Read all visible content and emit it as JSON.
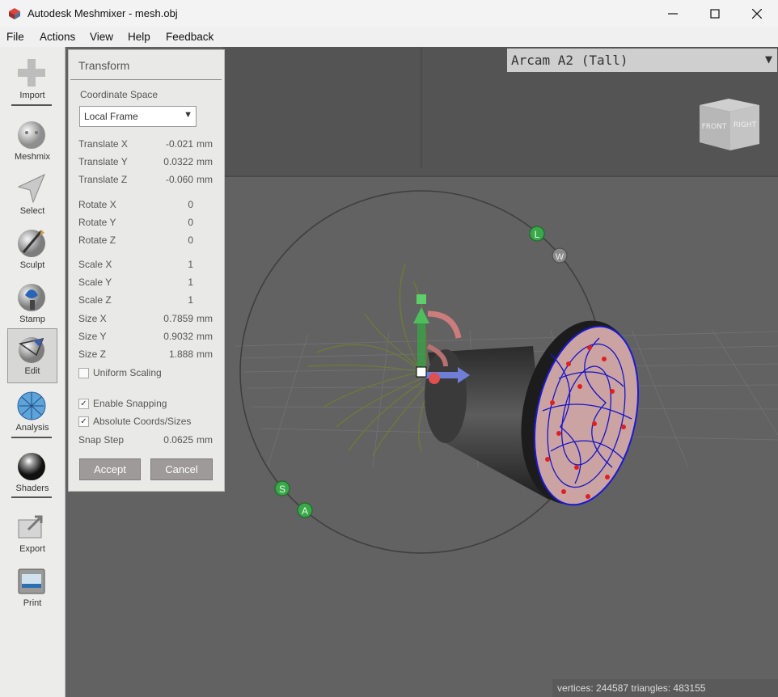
{
  "window": {
    "title": "Autodesk Meshmixer - mesh.obj"
  },
  "menu": [
    "File",
    "Actions",
    "View",
    "Help",
    "Feedback"
  ],
  "toolbar": {
    "items": [
      "Import",
      "Meshmix",
      "Select",
      "Sculpt",
      "Stamp",
      "Edit",
      "Analysis",
      "Shaders",
      "Export",
      "Print"
    ],
    "active": "Edit"
  },
  "printer": {
    "selected": "Arcam A2 (Tall)"
  },
  "viewcube": {
    "front": "FRONT",
    "right": "RIGHT"
  },
  "gizmo": {
    "handles": [
      "L",
      "W",
      "S",
      "A"
    ]
  },
  "panel": {
    "title": "Transform",
    "coord_label": "Coordinate Space",
    "coord_value": "Local Frame",
    "fields": [
      {
        "label": "Translate X",
        "value": "-0.021",
        "unit": "mm"
      },
      {
        "label": "Translate Y",
        "value": "0.0322",
        "unit": "mm"
      },
      {
        "label": "Translate Z",
        "value": "-0.060",
        "unit": "mm"
      },
      {
        "label": "Rotate X",
        "value": "0",
        "unit": ""
      },
      {
        "label": "Rotate Y",
        "value": "0",
        "unit": ""
      },
      {
        "label": "Rotate Z",
        "value": "0",
        "unit": ""
      },
      {
        "label": "Scale X",
        "value": "1",
        "unit": ""
      },
      {
        "label": "Scale Y",
        "value": "1",
        "unit": ""
      },
      {
        "label": "Scale Z",
        "value": "1",
        "unit": ""
      },
      {
        "label": "Size X",
        "value": "0.7859",
        "unit": "mm"
      },
      {
        "label": "Size Y",
        "value": "0.9032",
        "unit": "mm"
      },
      {
        "label": "Size Z",
        "value": "1.888",
        "unit": "mm"
      }
    ],
    "uniform_scaling": {
      "label": "Uniform Scaling",
      "checked": false
    },
    "enable_snapping": {
      "label": "Enable Snapping",
      "checked": true
    },
    "absolute_coords": {
      "label": "Absolute Coords/Sizes",
      "checked": true
    },
    "snap_step": {
      "label": "Snap Step",
      "value": "0.0625",
      "unit": "mm"
    },
    "accept": "Accept",
    "cancel": "Cancel"
  },
  "status": {
    "text": "vertices: 244587 triangles: 483155"
  }
}
